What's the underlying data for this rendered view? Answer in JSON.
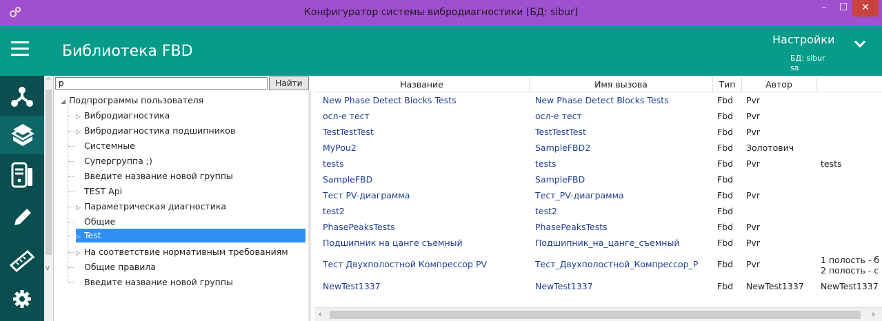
{
  "window": {
    "title": "Конфигуратор системы вибродиагностики [БД: sibur]",
    "controls": {
      "minimize": "–",
      "maximize": "☐",
      "close": "✕"
    }
  },
  "header": {
    "title": "Библиотека FBD",
    "settings_label": "Настройки",
    "db_label": "БД: sibur",
    "user_label": "sa"
  },
  "nav": {
    "items": [
      {
        "icon": "hierarchy-icon"
      },
      {
        "icon": "books-icon",
        "active": true
      },
      {
        "icon": "device-icon"
      },
      {
        "icon": "pencil-icon"
      },
      {
        "icon": "ruler-icon"
      },
      {
        "icon": "gear-icon"
      }
    ]
  },
  "search": {
    "value": "p",
    "button": "Найти"
  },
  "tree": {
    "root": "Подпрограммы пользователя",
    "items": [
      {
        "label": "Вибродиагностика",
        "expandable": true
      },
      {
        "label": "Вибродиагностика подшипников",
        "expandable": true
      },
      {
        "label": "Системные",
        "expandable": false
      },
      {
        "label": "Супергруппа ;)",
        "expandable": false
      },
      {
        "label": "Введите название новой группы",
        "expandable": false
      },
      {
        "label": "TEST Api",
        "expandable": false
      },
      {
        "label": "Параметрическая диагностика",
        "expandable": true
      },
      {
        "label": "Общие",
        "expandable": false
      },
      {
        "label": "Test",
        "expandable": true,
        "selected": true
      },
      {
        "label": "На соответствие нормативным требованиям",
        "expandable": true
      },
      {
        "label": "Общие правила",
        "expandable": false
      },
      {
        "label": "Введите название новой группы",
        "expandable": false
      }
    ]
  },
  "table": {
    "columns": [
      "Название",
      "Имя вызова",
      "Тип",
      "Автор",
      ""
    ],
    "rows": [
      [
        "New Phase Detect Blocks Tests",
        "New Phase Detect Blocks Tests",
        "Fbd",
        "Pvr",
        ""
      ],
      [
        "осл-е тест",
        "осл-е тест",
        "Fbd",
        "Pvr",
        ""
      ],
      [
        "TestTestTest",
        "TestTestTest",
        "Fbd",
        "Pvr",
        ""
      ],
      [
        "MyPou2",
        "SampleFBD2",
        "Fbd",
        "Золотович",
        ""
      ],
      [
        "tests",
        "tests",
        "Fbd",
        "Pvr",
        "tests"
      ],
      [
        "SampleFBD",
        "SampleFBD",
        "Fbd",
        "",
        ""
      ],
      [
        "Тест PV-диаграмма",
        "Тест_PV-диаграмма",
        "Fbd",
        "Pvr",
        ""
      ],
      [
        "test2",
        "test2",
        "Fbd",
        "",
        ""
      ],
      [
        "PhasePeaksTests",
        "PhasePeaksTests",
        "Fbd",
        "Pvr",
        ""
      ],
      [
        "Подшипник на цанге съемный",
        "Подшипник_на_цанге_съемный",
        "Fbd",
        "Pvr",
        ""
      ],
      [
        "Тест Двухполостной Компрессор PV",
        "Тест_Двухполостной_Компрессор_P",
        "Fbd",
        "Pvr",
        "1 полость - б"
      ],
      [
        "NewTest1337",
        "NewTest1337",
        "Fbd",
        "NewTest1337",
        "NewTest1337"
      ]
    ],
    "row11_desc_line2": "2 полость - с"
  },
  "scrollbar": {
    "left": "‹",
    "right": "›"
  },
  "colors": {
    "titlebar": "#a04fd0",
    "header": "#079c89",
    "nav": "#0a4e4f",
    "selection": "#2f8ff2"
  }
}
